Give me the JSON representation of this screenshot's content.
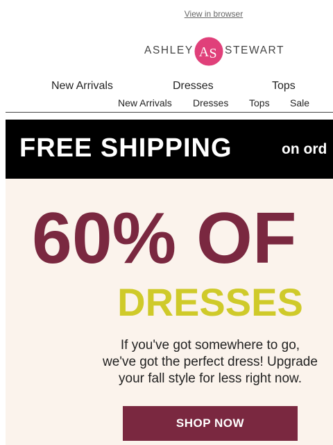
{
  "header": {
    "view_in_browser": "View in browser"
  },
  "logo": {
    "left": "ASHLEY",
    "right": "STEWART",
    "mark": "AS"
  },
  "nav_primary": [
    "New Arrivals",
    "Dresses",
    "Tops"
  ],
  "nav_secondary": [
    "New Arrivals",
    "Dresses",
    "Tops",
    "Sale"
  ],
  "shipping_banner": {
    "headline": "FREE SHIPPING",
    "tail": "on ord"
  },
  "hero": {
    "headline": "60% OF",
    "subhead": "DRESSES",
    "body": [
      "If you've got somewhere to go,",
      "we've got the perfect dress! Upgrade",
      "your fall style for less right now."
    ],
    "cta": "SHOP NOW"
  },
  "colors": {
    "brand_maroon": "#7a2840",
    "accent_yellow": "#cfca2a",
    "logo_pink": "#e0407a",
    "hero_bg": "#fbf3ec"
  }
}
